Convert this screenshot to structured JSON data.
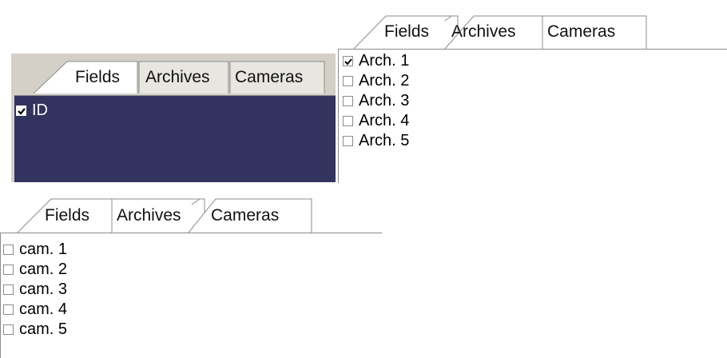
{
  "panel_fields": {
    "tabs": [
      {
        "label": "Fields",
        "active": true
      },
      {
        "label": "Archives",
        "active": false
      },
      {
        "label": "Cameras",
        "active": false
      }
    ],
    "items": [
      {
        "label": "ID",
        "checked": true
      }
    ],
    "list_bg_color": "#33335f"
  },
  "panel_archives": {
    "tabs": [
      {
        "label": "Fields",
        "active": false
      },
      {
        "label": "Archives",
        "active": true
      },
      {
        "label": "Cameras",
        "active": false
      }
    ],
    "items": [
      {
        "label": "Arch. 1",
        "checked": true
      },
      {
        "label": "Arch. 2",
        "checked": false
      },
      {
        "label": "Arch. 3",
        "checked": false
      },
      {
        "label": "Arch. 4",
        "checked": false
      },
      {
        "label": "Arch. 5",
        "checked": false
      }
    ]
  },
  "panel_cameras": {
    "tabs": [
      {
        "label": "Fields",
        "active": false
      },
      {
        "label": "Archives",
        "active": false
      },
      {
        "label": "Cameras",
        "active": true
      }
    ],
    "items": [
      {
        "label": "cam. 1",
        "checked": false
      },
      {
        "label": "cam. 2",
        "checked": false
      },
      {
        "label": "cam. 3",
        "checked": false
      },
      {
        "label": "cam. 4",
        "checked": false
      },
      {
        "label": "cam. 5",
        "checked": false
      }
    ]
  }
}
